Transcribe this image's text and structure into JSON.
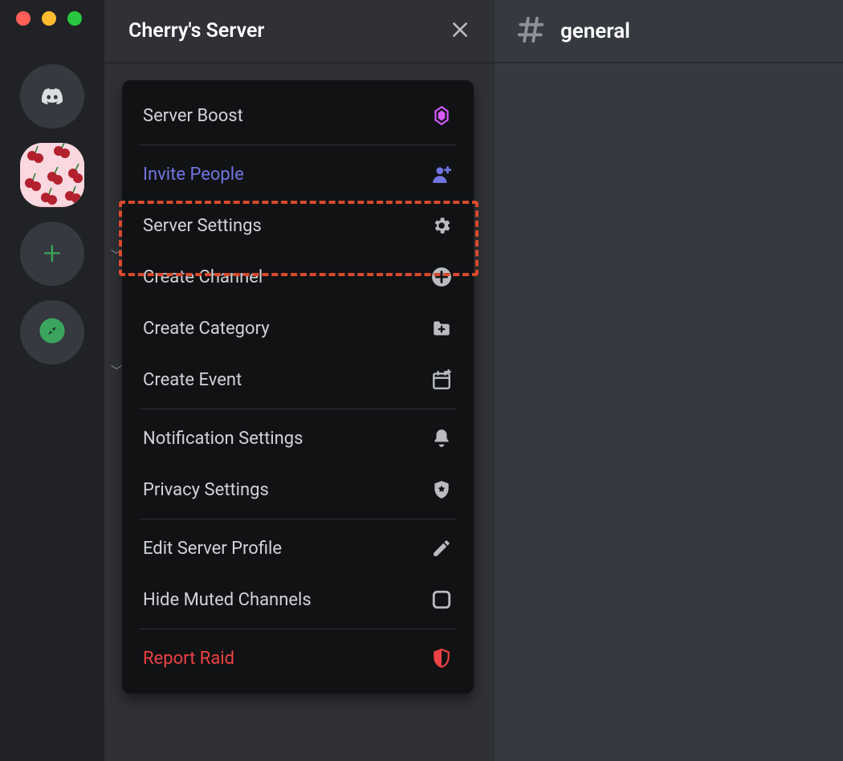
{
  "server": {
    "name": "Cherry's Server"
  },
  "channel": {
    "name": "general"
  },
  "menu": {
    "boost": "Server Boost",
    "invite": "Invite People",
    "settings": "Server Settings",
    "createChannel": "Create Channel",
    "createCategory": "Create Category",
    "createEvent": "Create Event",
    "notification": "Notification Settings",
    "privacy": "Privacy Settings",
    "editProfile": "Edit Server Profile",
    "hideMuted": "Hide Muted Channels",
    "reportRaid": "Report Raid"
  },
  "highlighted_item": "settings",
  "colors": {
    "railBg": "#202225",
    "channelsBg": "#2f3136",
    "chatBg": "#36393f",
    "menuBg": "#111214",
    "inviteAccent": "#7175e0",
    "danger": "#ed4245",
    "boostPink": "#d65aff",
    "highlight": "#d84a2b",
    "green": "#3ba55d"
  },
  "icons": {
    "boost": "boost-gem-icon",
    "invite": "person-plus-icon",
    "settings": "gear-icon",
    "createChannel": "plus-circle-icon",
    "createCategory": "folder-plus-icon",
    "createEvent": "calendar-plus-icon",
    "notification": "bell-icon",
    "privacy": "shield-star-icon",
    "editProfile": "pencil-icon",
    "hideMuted": "checkbox-empty-icon",
    "reportRaid": "shield-alert-icon"
  }
}
